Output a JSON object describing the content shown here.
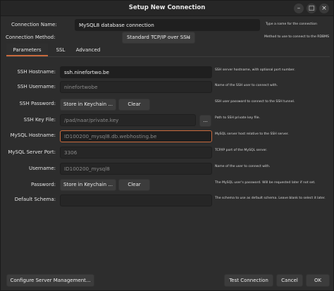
{
  "window": {
    "title": "Setup New Connection",
    "controls": {
      "minimize": "–",
      "maximize": "□",
      "close": "×"
    }
  },
  "connection_name": {
    "label": "Connection Name:",
    "value": "MySQL8 database connection",
    "hint": "Type a name for the connection"
  },
  "connection_method": {
    "label": "Connection Method:",
    "value": "Standard TCP/IP over SSH",
    "hint": "Method to use to connect to the RDBMS"
  },
  "tabs": [
    {
      "label": "Parameters",
      "active": true
    },
    {
      "label": "SSL",
      "active": false
    },
    {
      "label": "Advanced",
      "active": false
    }
  ],
  "params": {
    "ssh_hostname": {
      "label": "SSH Hostname:",
      "value": "ssh.ninefortwo.be",
      "hint": "SSH server hostname, with  optional port number."
    },
    "ssh_username": {
      "label": "SSH Username:",
      "value": "ninefortwobe",
      "hint": "Name of the SSH user to connect with."
    },
    "ssh_password": {
      "label": "SSH Password:",
      "store_label": "Store in Keychain ...",
      "clear_label": "Clear",
      "hint": "SSH user password to connect to the SSH tunnel."
    },
    "ssh_key_file": {
      "label": "SSH Key File:",
      "value": "/pad/naar/private.key",
      "browse_label": "...",
      "hint": "Path to SSH private key file."
    },
    "mysql_hostname": {
      "label": "MySQL Hostname:",
      "value": "ID100200_mysql8.db.webhosting.be",
      "hint": "MySQL server host relative to the SSH server."
    },
    "mysql_port": {
      "label": "MySQL Server Port:",
      "value": "3306",
      "hint": "TCP/IP port of the MySQL server."
    },
    "username": {
      "label": "Username:",
      "value": "ID100200_mysql8",
      "hint": "Name of the user to connect with."
    },
    "password": {
      "label": "Password:",
      "store_label": "Store in Keychain ...",
      "clear_label": "Clear",
      "hint": "The MySQL user's password. Will be requested later if not set."
    },
    "default_schema": {
      "label": "Default Schema:",
      "value": "",
      "hint": "The schema to use as default schema. Leave blank to select it later."
    }
  },
  "footer": {
    "configure_label": "Configure Server Management...",
    "test_label": "Test Connection",
    "cancel_label": "Cancel",
    "ok_label": "OK"
  },
  "colors": {
    "accent": "#c96a3d",
    "background": "#2d2d2d",
    "field": "#1f1f1f"
  }
}
